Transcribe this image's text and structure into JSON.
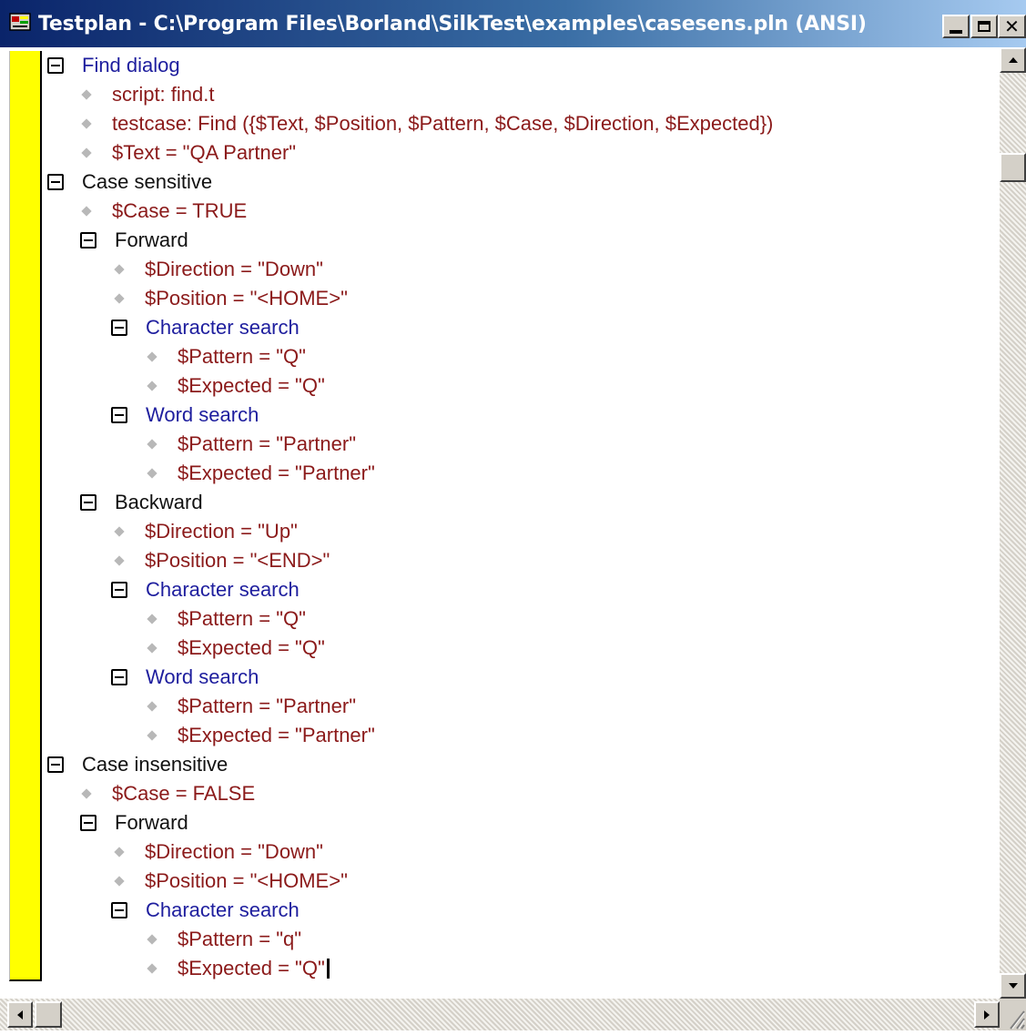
{
  "window": {
    "title": "Testplan - C:\\Program Files\\Borland\\SilkTest\\examples\\casesens.pln (ANSI)",
    "icon": "testplan-app-icon",
    "caption_buttons": [
      "minimize-icon",
      "maximize-icon",
      "close-icon"
    ]
  },
  "colors": {
    "description": "#1e1e9e",
    "plain": "#111111",
    "statement": "#8b1a1a",
    "margin": "#ffff00"
  },
  "tree": [
    {
      "text": "Find dialog",
      "level": 0,
      "kind": "group",
      "style": "blue"
    },
    {
      "text": "script: find.t",
      "level": 1,
      "kind": "item",
      "style": "red"
    },
    {
      "text": "testcase: Find ({$Text, $Position, $Pattern, $Case, $Direction, $Expected})",
      "level": 1,
      "kind": "item",
      "style": "red"
    },
    {
      "text": "$Text = \"QA Partner\"",
      "level": 1,
      "kind": "item",
      "style": "red"
    },
    {
      "text": "Case sensitive",
      "level": 0,
      "kind": "group",
      "style": "black"
    },
    {
      "text": "$Case = TRUE",
      "level": 1,
      "kind": "item",
      "style": "red"
    },
    {
      "text": "Forward",
      "level": 1,
      "kind": "group",
      "style": "black"
    },
    {
      "text": "$Direction = \"Down\"",
      "level": 2,
      "kind": "item",
      "style": "red"
    },
    {
      "text": "$Position = \"<HOME>\"",
      "level": 2,
      "kind": "item",
      "style": "red"
    },
    {
      "text": "Character search",
      "level": 2,
      "kind": "group",
      "style": "blue"
    },
    {
      "text": "$Pattern = \"Q\"",
      "level": 3,
      "kind": "item",
      "style": "red"
    },
    {
      "text": "$Expected = \"Q\"",
      "level": 3,
      "kind": "item",
      "style": "red"
    },
    {
      "text": "Word search",
      "level": 2,
      "kind": "group",
      "style": "blue"
    },
    {
      "text": "$Pattern = \"Partner\"",
      "level": 3,
      "kind": "item",
      "style": "red"
    },
    {
      "text": "$Expected = \"Partner\"",
      "level": 3,
      "kind": "item",
      "style": "red"
    },
    {
      "text": "Backward",
      "level": 1,
      "kind": "group",
      "style": "black"
    },
    {
      "text": "$Direction = \"Up\"",
      "level": 2,
      "kind": "item",
      "style": "red"
    },
    {
      "text": "$Position = \"<END>\"",
      "level": 2,
      "kind": "item",
      "style": "red"
    },
    {
      "text": "Character search",
      "level": 2,
      "kind": "group",
      "style": "blue"
    },
    {
      "text": "$Pattern = \"Q\"",
      "level": 3,
      "kind": "item",
      "style": "red"
    },
    {
      "text": "$Expected = \"Q\"",
      "level": 3,
      "kind": "item",
      "style": "red"
    },
    {
      "text": "Word search",
      "level": 2,
      "kind": "group",
      "style": "blue"
    },
    {
      "text": "$Pattern = \"Partner\"",
      "level": 3,
      "kind": "item",
      "style": "red"
    },
    {
      "text": "$Expected = \"Partner\"",
      "level": 3,
      "kind": "item",
      "style": "red"
    },
    {
      "text": "Case insensitive",
      "level": 0,
      "kind": "group",
      "style": "black"
    },
    {
      "text": "$Case = FALSE",
      "level": 1,
      "kind": "item",
      "style": "red"
    },
    {
      "text": "Forward",
      "level": 1,
      "kind": "group",
      "style": "black"
    },
    {
      "text": "$Direction = \"Down\"",
      "level": 2,
      "kind": "item",
      "style": "red"
    },
    {
      "text": "$Position = \"<HOME>\"",
      "level": 2,
      "kind": "item",
      "style": "red"
    },
    {
      "text": "Character search",
      "level": 2,
      "kind": "group",
      "style": "blue"
    },
    {
      "text": "$Pattern = \"q\"",
      "level": 3,
      "kind": "item",
      "style": "red"
    },
    {
      "text": "$Expected = \"Q\"",
      "level": 3,
      "kind": "item",
      "style": "red",
      "caret": true
    }
  ],
  "scrollbars": {
    "vertical": {
      "up": "scroll-up-arrow-icon",
      "down": "scroll-down-arrow-icon"
    },
    "horizontal": {
      "left": "scroll-left-arrow-icon",
      "right": "scroll-right-arrow-icon"
    }
  }
}
